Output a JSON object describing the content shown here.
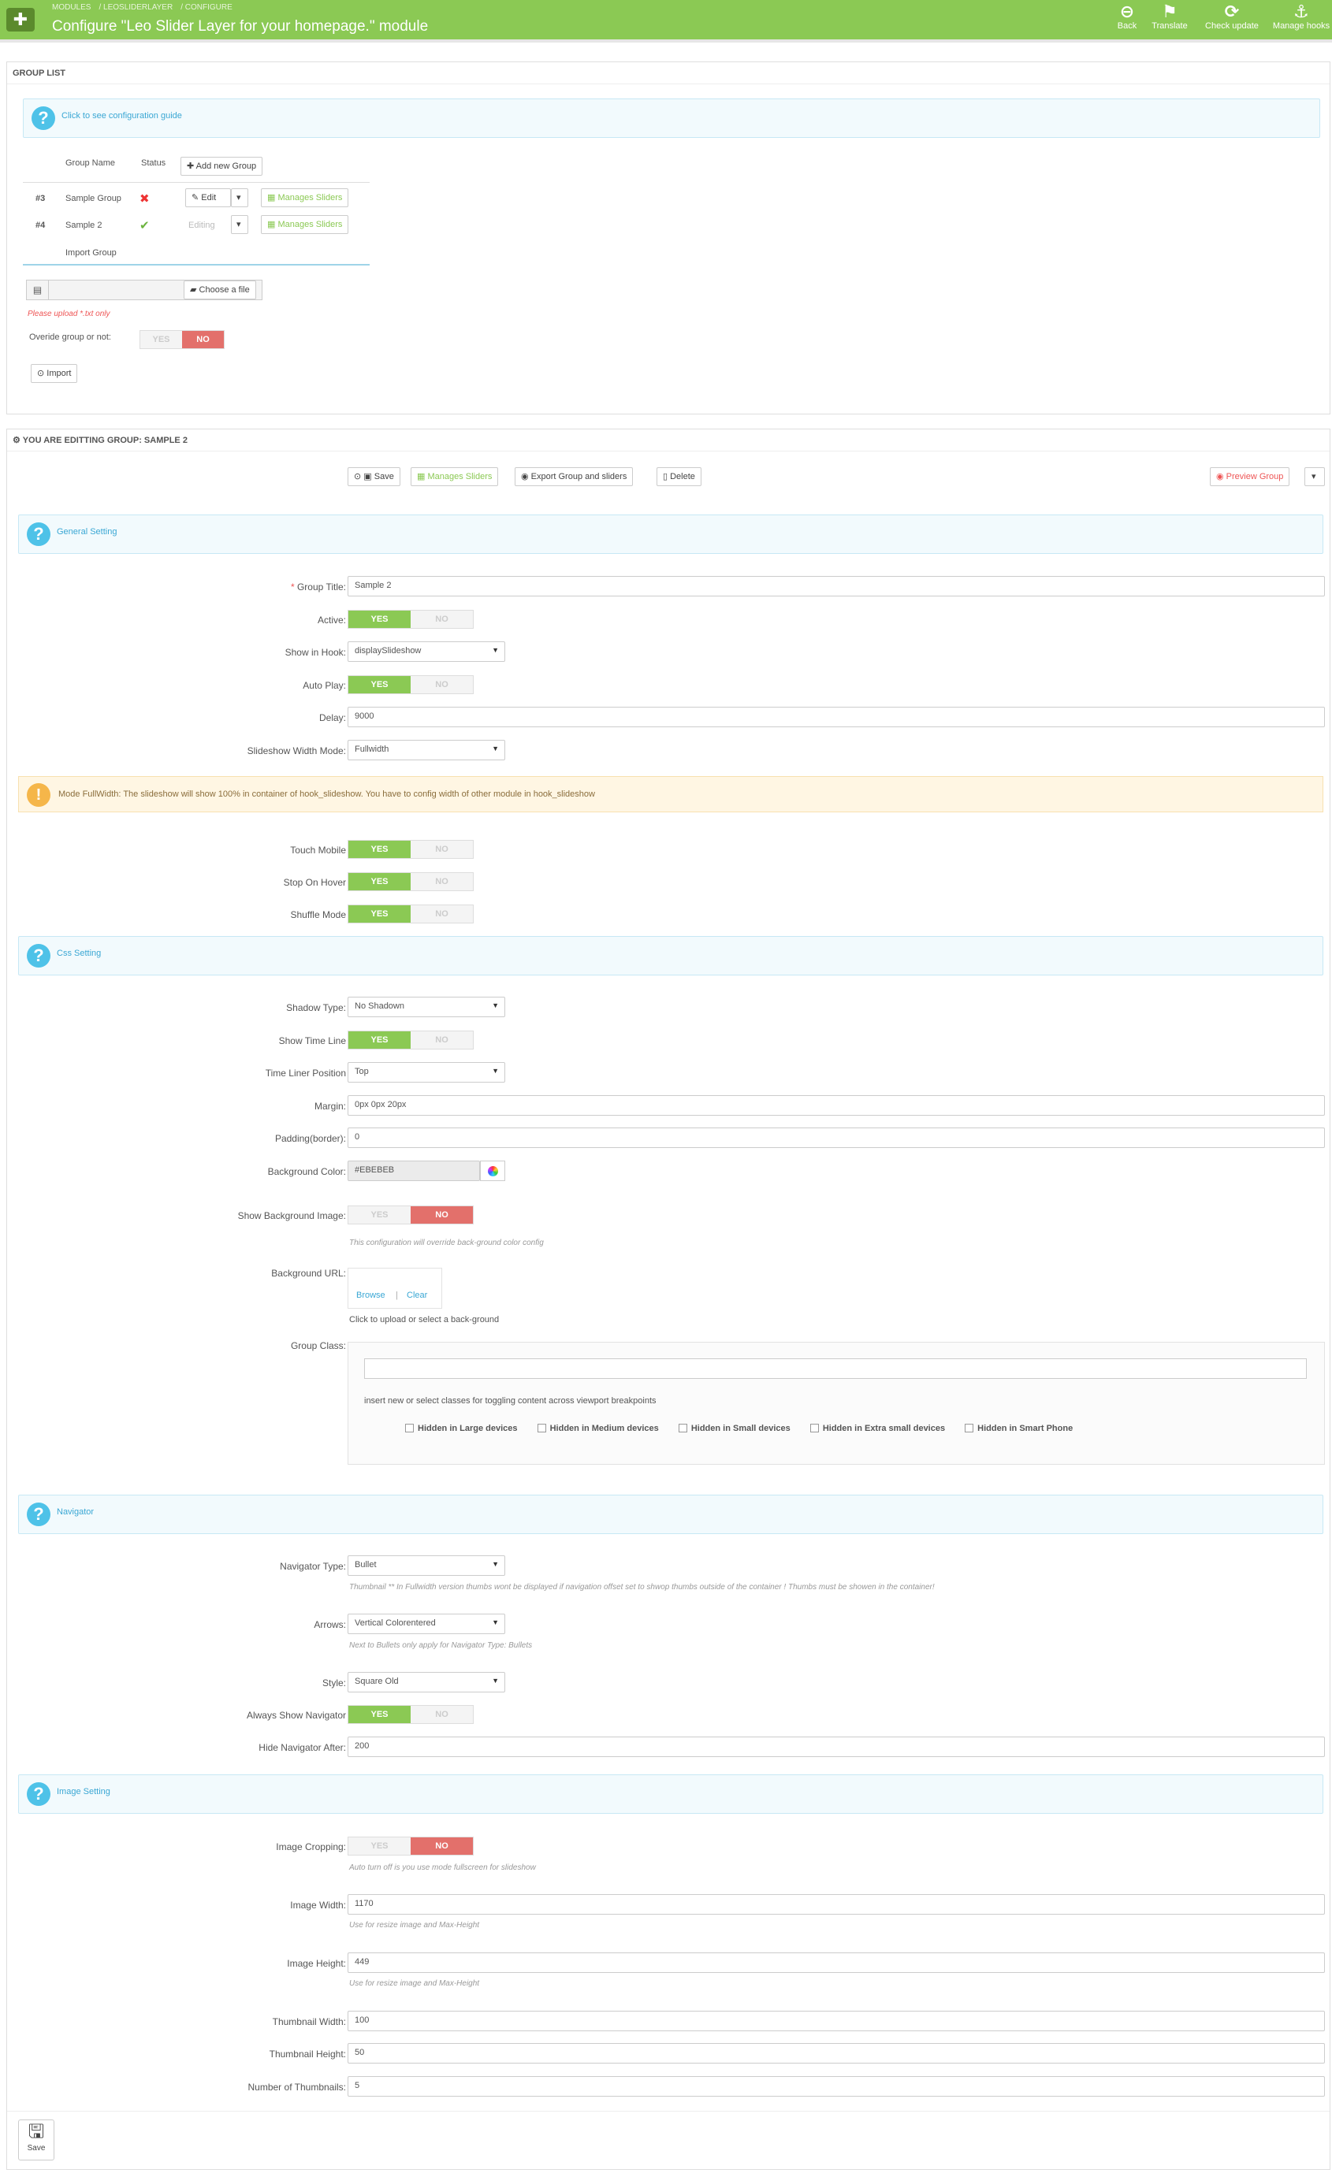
{
  "topbar": {
    "breadcrumb": [
      "MODULES",
      "LEOSLIDERLAYER",
      "CONFIGURE"
    ],
    "title": "Configure \"Leo Slider Layer for your homepage.\" module",
    "buttons": [
      {
        "label": "Back",
        "icon": "back-icon"
      },
      {
        "label": "Translate",
        "icon": "flag-icon"
      },
      {
        "label": "Check update",
        "icon": "refresh-icon"
      },
      {
        "label": "Manage hooks",
        "icon": "anchor-icon"
      }
    ]
  },
  "group_list": {
    "heading": "GROUP LIST",
    "guide_link": "Click to see configuration guide",
    "col_name": "Group Name",
    "col_status": "Status",
    "add_button": "Add new Group",
    "groups": [
      {
        "id": "#3",
        "name": "Sample Group",
        "status": "✖",
        "action": "Edit",
        "manage": "Manages Sliders"
      },
      {
        "id": "#4",
        "name": "Sample 2",
        "status": "✔",
        "action": "Editing",
        "manage": "Manages Sliders"
      }
    ],
    "import_title": "Import Group",
    "choose_file": "Choose a file",
    "upload_hint": "Please upload *.txt only",
    "override_label": "Overide group or not:",
    "yes": "YES",
    "no": "NO",
    "import_button": "Import"
  },
  "editing": {
    "heading": "YOU ARE EDITTING GROUP: SAMPLE 2",
    "toolbar": {
      "save": "Save",
      "manages": "Manages Sliders",
      "export": "Export Group and sliders",
      "delete": "Delete",
      "preview": "Preview Group"
    },
    "general_setting": "General Setting",
    "group_title_label": "Group Title:",
    "group_title": "Sample 2",
    "active_label": "Active:",
    "show_in_hook_label": "Show in Hook:",
    "show_in_hook": "displaySlideshow",
    "auto_play_label": "Auto Play:",
    "delay_label": "Delay:",
    "delay": "9000",
    "width_mode_label": "Slideshow Width Mode:",
    "width_mode": "Fullwidth",
    "warning": "Mode FullWidth: The slideshow will show 100% in container of hook_slideshow. You have to config width of other module in hook_slideshow",
    "touch_mobile_label": "Touch Mobile",
    "stop_on_hover_label": "Stop On Hover",
    "shuffle_label": "Shuffle Mode",
    "css_setting": "Css Setting",
    "shadow_type_label": "Shadow Type:",
    "shadow_type": "No Shadown",
    "show_timeline_label": "Show Time Line",
    "timeline_pos_label": "Time Liner Position",
    "timeline_pos": "Top",
    "margin_label": "Margin:",
    "margin": "0px 0px 20px",
    "padding_label": "Padding(border):",
    "padding": "0",
    "bgcolor_label": "Background Color:",
    "bgcolor": "#EBEBEB",
    "show_bg_label": "Show Background Image:",
    "show_bg_help": "This configuration will override back-ground color config",
    "bg_url_label": "Background URL:",
    "browse": "Browse",
    "clear": "Clear",
    "bg_url_help": "Click to upload or select a back-ground",
    "group_class_label": "Group Class:",
    "group_class_help": "insert new or select classes for toggling content across viewport breakpoints",
    "class_options": [
      "Hidden in Large devices",
      "Hidden in Medium devices",
      "Hidden in Small devices",
      "Hidden in Extra small devices",
      "Hidden in Smart Phone"
    ],
    "navigator": "Navigator",
    "nav_type_label": "Navigator Type:",
    "nav_type": "Bullet",
    "nav_type_help": "Thumbnail ** In Fullwidth version thumbs wont be displayed if navigation offset set to shwop thumbs outside of the container ! Thumbs must be showen in the container!",
    "arrows_label": "Arrows:",
    "arrows": "Vertical Colorentered",
    "arrows_help": "Next to Bullets only apply for Navigator Type: Bullets",
    "style_label": "Style:",
    "style": "Square Old",
    "always_nav_label": "Always Show Navigator",
    "hide_nav_label": "Hide Navigator After:",
    "hide_nav": "200",
    "image_setting": "Image Setting",
    "crop_label": "Image Cropping:",
    "crop_help": "Auto turn off is you use mode fullscreen for slideshow",
    "img_width_label": "Image Width:",
    "img_width": "1170",
    "img_width_help": "Use for resize image and Max-Height",
    "img_height_label": "Image Height:",
    "img_height": "449",
    "img_height_help": "Use for resize image and Max-Height",
    "thumb_width_label": "Thumbnail Width:",
    "thumb_width": "100",
    "thumb_height_label": "Thumbnail Height:",
    "thumb_height": "50",
    "num_thumbs_label": "Number of Thumbnails:",
    "num_thumbs": "5",
    "footer_save": "Save"
  },
  "colors": {
    "brand": "#8bc954",
    "info": "#4ec2e8",
    "danger": "#e3706b",
    "warning": "#f5b64a"
  }
}
